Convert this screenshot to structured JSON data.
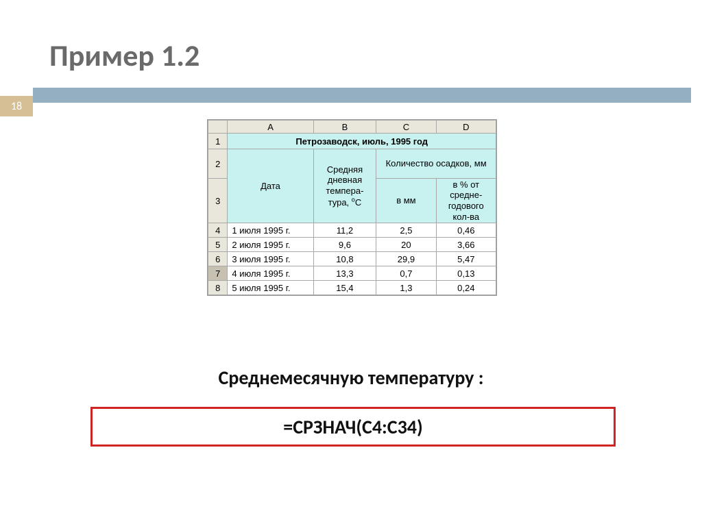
{
  "slide_number": "18",
  "title": "Пример 1.2",
  "caption": "Среднемесячную температуру :",
  "formula": "=СРЗНАЧ(C4:C34)",
  "sheet": {
    "col_labels": [
      "A",
      "B",
      "C",
      "D"
    ],
    "row_labels": [
      "1",
      "2",
      "3",
      "4",
      "5",
      "6",
      "7",
      "8"
    ],
    "selected_row": "7",
    "title_merged": "Петрозаводск, июль, 1995 год",
    "headers": {
      "date": "Дата",
      "temp": "Средняя дневная темпера-тура, °С",
      "precip_group": "Количество осадков, мм",
      "precip_mm": "в мм",
      "precip_pct": "в % от средне-годового кол-ва"
    },
    "rows": [
      {
        "date": "1 июля 1995 г.",
        "temp": "11,2",
        "mm": "2,5",
        "pct": "0,46"
      },
      {
        "date": "2 июля 1995 г.",
        "temp": "9,6",
        "mm": "20",
        "pct": "3,66"
      },
      {
        "date": "3 июля 1995 г.",
        "temp": "10,8",
        "mm": "29,9",
        "pct": "5,47"
      },
      {
        "date": "4 июля 1995 г.",
        "temp": "13,3",
        "mm": "0,7",
        "pct": "0,13"
      },
      {
        "date": "5 июля 1995 г.",
        "temp": "15,4",
        "mm": "1,3",
        "pct": "0,24"
      }
    ]
  }
}
